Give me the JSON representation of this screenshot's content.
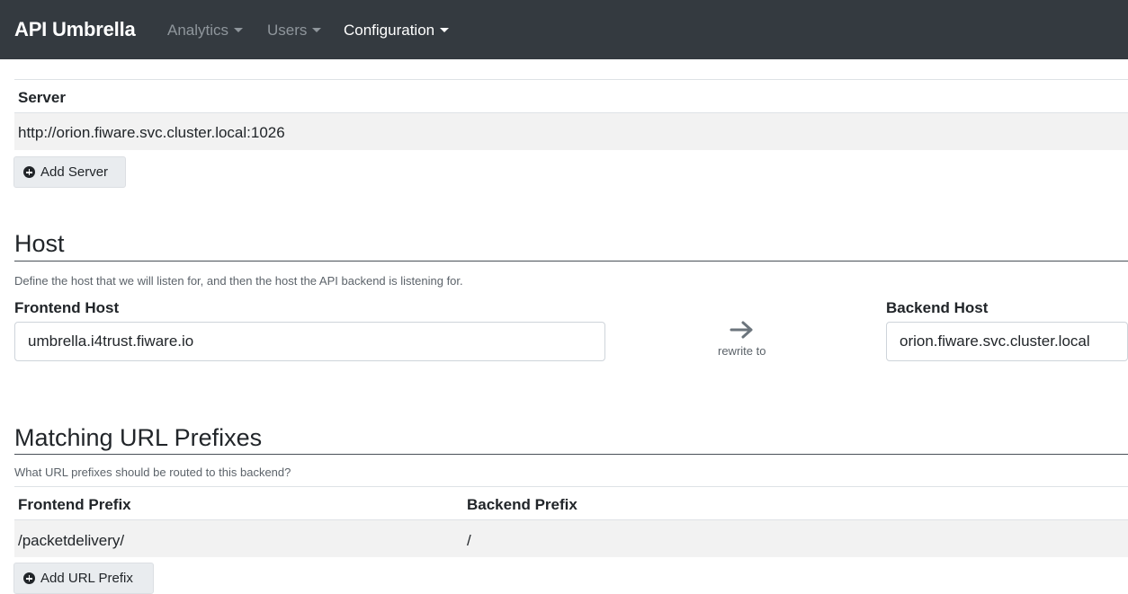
{
  "navbar": {
    "brand": "API Umbrella",
    "items": [
      {
        "label": "Analytics",
        "active": false
      },
      {
        "label": "Users",
        "active": false
      },
      {
        "label": "Configuration",
        "active": true
      }
    ],
    "bg_color": "#343a40"
  },
  "servers": {
    "header": "Server",
    "rows": [
      "http://orion.fiware.svc.cluster.local:1026"
    ],
    "add_label": "Add Server"
  },
  "host": {
    "title": "Host",
    "help": "Define the host that we will listen for, and then the host the API backend is listening for.",
    "frontend_label": "Frontend Host",
    "frontend_value": "umbrella.i4trust.fiware.io",
    "rewrite_label": "rewrite to",
    "backend_label": "Backend Host",
    "backend_value": "orion.fiware.svc.cluster.local"
  },
  "url_prefixes": {
    "title": "Matching URL Prefixes",
    "help": "What URL prefixes should be routed to this backend?",
    "col_frontend": "Frontend Prefix",
    "col_backend": "Backend Prefix",
    "rows": [
      {
        "frontend": "/packetdelivery/",
        "backend": "/"
      }
    ],
    "add_label": "Add URL Prefix"
  }
}
